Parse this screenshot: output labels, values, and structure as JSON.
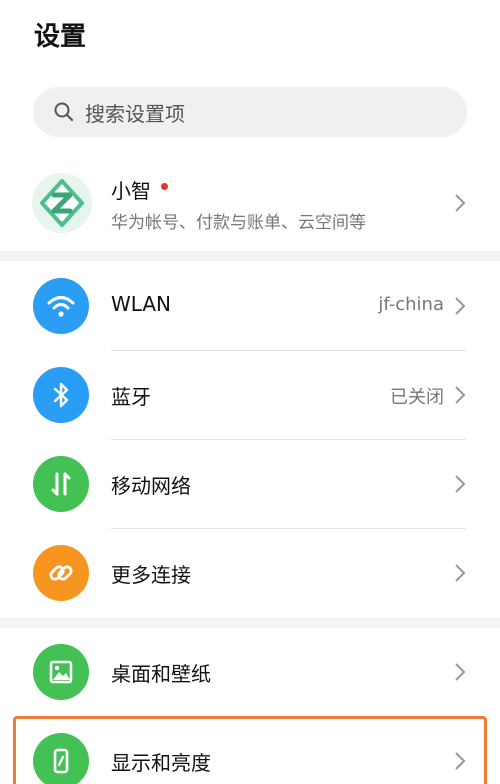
{
  "header": {
    "title": "设置"
  },
  "search": {
    "placeholder": "搜索设置项"
  },
  "account": {
    "name": "小智",
    "subtitle": "华为帐号、付款与账单、云空间等"
  },
  "rows": [
    {
      "label": "WLAN",
      "value": "jf-china",
      "icon": "wifi-icon",
      "color": "#2a9df4"
    },
    {
      "label": "蓝牙",
      "value": "已关闭",
      "icon": "bluetooth-icon",
      "color": "#2a9df4"
    },
    {
      "label": "移动网络",
      "value": "",
      "icon": "mobile-network-icon",
      "color": "#43c154"
    },
    {
      "label": "更多连接",
      "value": "",
      "icon": "link-icon",
      "color": "#f6951f"
    },
    {
      "label": "桌面和壁纸",
      "value": "",
      "icon": "wallpaper-icon",
      "color": "#43c154"
    },
    {
      "label": "显示和亮度",
      "value": "",
      "icon": "display-brightness-icon",
      "color": "#43c154"
    }
  ],
  "colors": {
    "highlight": "#ee7b3a",
    "notification_dot": "#e0382a"
  }
}
